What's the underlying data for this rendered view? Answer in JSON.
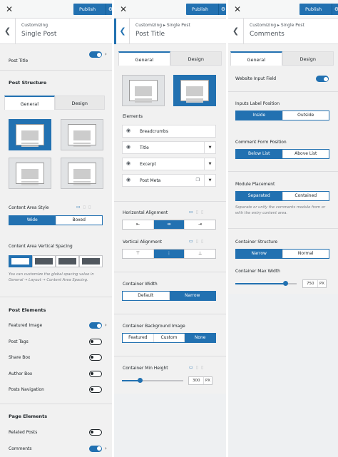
{
  "topbar": {
    "publish_label": "Publish",
    "gear": "⚙",
    "close": "✕"
  },
  "p1": {
    "crumb": "Customizing",
    "title": "Single Post",
    "post_title": "Post Title",
    "post_structure": "Post Structure",
    "tabs": [
      "General",
      "Design"
    ],
    "content_area_style": "Content Area Style",
    "style_options": [
      "Wide",
      "Boxed"
    ],
    "vertical_spacing": "Content Area Vertical Spacing",
    "spacing_hint": "You can customize the global spacing value in General → Layout → Content Area Spacing.",
    "post_elements": "Post Elements",
    "elements": [
      {
        "label": "Featured Image",
        "on": true,
        "chevron": true
      },
      {
        "label": "Post Tags",
        "on": false,
        "chevron": false
      },
      {
        "label": "Share Box",
        "on": false,
        "chevron": false
      },
      {
        "label": "Author Box",
        "on": false,
        "chevron": false
      },
      {
        "label": "Posts Navigation",
        "on": false,
        "chevron": false
      }
    ],
    "page_elements": "Page Elements",
    "page_items": [
      {
        "label": "Related Posts",
        "on": false,
        "chevron": false
      },
      {
        "label": "Comments",
        "on": true,
        "chevron": true
      }
    ]
  },
  "p2": {
    "crumb": "Customizing ▸ Single Post",
    "title": "Post Title",
    "tabs": [
      "General",
      "Design"
    ],
    "elements_label": "Elements",
    "elements": [
      {
        "label": "Breadcrumbs",
        "dropdown": false,
        "copy": false
      },
      {
        "label": "Title",
        "dropdown": true,
        "copy": false
      },
      {
        "label": "Excerpt",
        "dropdown": true,
        "copy": false
      },
      {
        "label": "Post Meta",
        "dropdown": true,
        "copy": true
      }
    ],
    "horizontal_alignment": "Horizontal Alignment",
    "vertical_alignment": "Vertical Alignment",
    "container_width": "Container Width",
    "width_options": [
      "Default",
      "Narrow"
    ],
    "bg_image": "Container Background Image",
    "bg_options": [
      "Featured",
      "Custom",
      "None"
    ],
    "min_height": "Container Min Height",
    "min_height_value": "300",
    "min_height_unit": "PX",
    "min_height_fraction": 0.3
  },
  "p3": {
    "crumb": "Customizing ▸ Single Post",
    "title": "Comments",
    "tabs": [
      "General",
      "Design"
    ],
    "website_field": "Website Input Field",
    "label_position": "Inputs Label Position",
    "label_options": [
      "Inside",
      "Outside"
    ],
    "form_position": "Comment Form Position",
    "form_options": [
      "Below List",
      "Above List"
    ],
    "module_placement": "Module Placement",
    "placement_options": [
      "Separated",
      "Contained"
    ],
    "placement_hint": "Separate or unify the comments module from or with the entry content area.",
    "container_structure": "Container Structure",
    "structure_options": [
      "Narrow",
      "Normal"
    ],
    "max_width": "Container Max Width",
    "max_width_value": "750",
    "max_width_unit": "PX",
    "max_width_fraction": 0.82
  },
  "colors": {
    "accent": "#2271b1",
    "panel": "#f1f1f1"
  },
  "icons": {
    "desktop": "desktop-icon",
    "tablet": "tablet-icon",
    "mobile": "mobile-icon",
    "eye": "eye-icon"
  }
}
